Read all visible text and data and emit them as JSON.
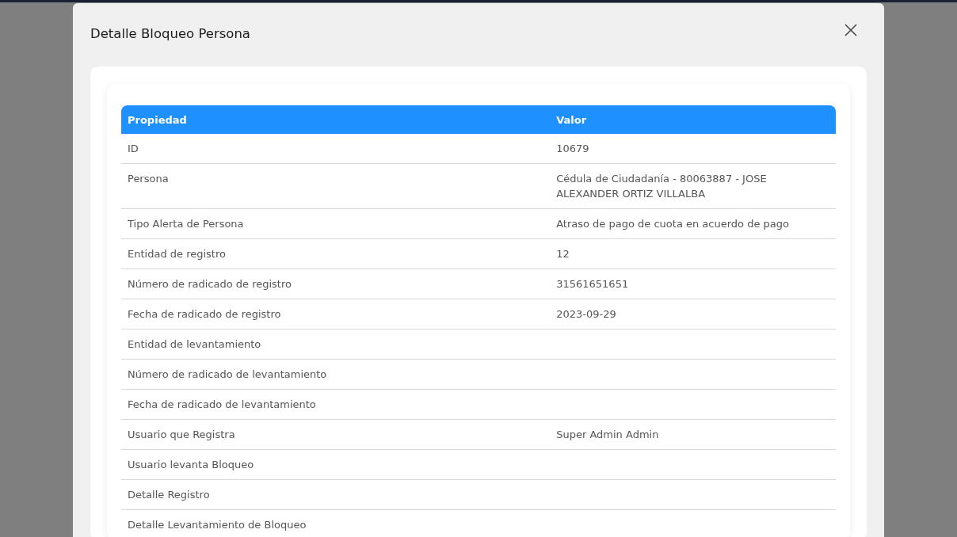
{
  "dialog": {
    "title": "Detalle Bloqueo Persona"
  },
  "table": {
    "columns": [
      "Propiedad",
      "Valor"
    ],
    "rows": [
      {
        "property": "ID",
        "value": "10679"
      },
      {
        "property": "Persona",
        "value": "Cédula de Ciudadanía - 80063887 - JOSE ALEXANDER ORTIZ VILLALBA"
      },
      {
        "property": "Tipo Alerta de Persona",
        "value": "Atraso de pago de cuota en acuerdo de pago"
      },
      {
        "property": "Entidad de registro",
        "value": "12"
      },
      {
        "property": "Número de radicado de registro",
        "value": "31561651651"
      },
      {
        "property": "Fecha de radicado de registro",
        "value": "2023-09-29"
      },
      {
        "property": "Entidad de levantamiento"
      },
      {
        "property": "Número de radicado de levantamiento"
      },
      {
        "property": "Fecha de radicado de levantamiento"
      },
      {
        "property": "Usuario que Registra",
        "value": "Super Admin Admin"
      },
      {
        "property": "Usuario levanta Bloqueo"
      },
      {
        "property": "Detalle Registro"
      },
      {
        "property": "Detalle Levantamiento de Bloqueo"
      }
    ]
  }
}
